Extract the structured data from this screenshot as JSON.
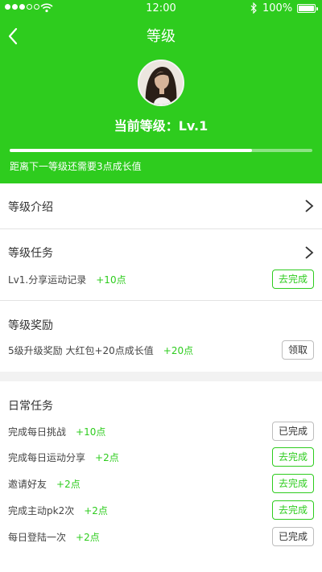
{
  "status_bar": {
    "time": "12:00",
    "battery": "100%"
  },
  "nav": {
    "title": "等级"
  },
  "profile": {
    "level_text": "当前等级：Lv.1",
    "progress": 0.8,
    "progress_text": "距离下一等级还需要3点成长值"
  },
  "sections": {
    "intro": {
      "title": "等级介绍"
    },
    "tasks": {
      "title": "等级任务",
      "items": [
        {
          "name": "Lv1.分享运动记录",
          "points": "+10点",
          "action": "去完成"
        }
      ]
    },
    "rewards": {
      "title": "等级奖励",
      "items": [
        {
          "name": "5级升级奖励 大红包+20点成长值",
          "points": "+20点",
          "action": "领取"
        }
      ]
    },
    "daily": {
      "title": "日常任务",
      "items": [
        {
          "name": "完成每日挑战",
          "points": "+10点",
          "action": "已完成"
        },
        {
          "name": "完成每日运动分享",
          "points": "+2点",
          "action": "去完成"
        },
        {
          "name": "邀请好友",
          "points": "+2点",
          "action": "去完成"
        },
        {
          "name": "完成主动pk2次",
          "points": "+2点",
          "action": "去完成"
        },
        {
          "name": "每日登陆一次",
          "points": "+2点",
          "action": "已完成"
        }
      ]
    }
  },
  "colors": {
    "accent": "#2ecc1e",
    "done_border": "#bdbdbd"
  },
  "icons": [
    "back-icon",
    "chevron-right-icon",
    "wifi-icon",
    "bluetooth-icon",
    "battery-icon",
    "avatar"
  ]
}
